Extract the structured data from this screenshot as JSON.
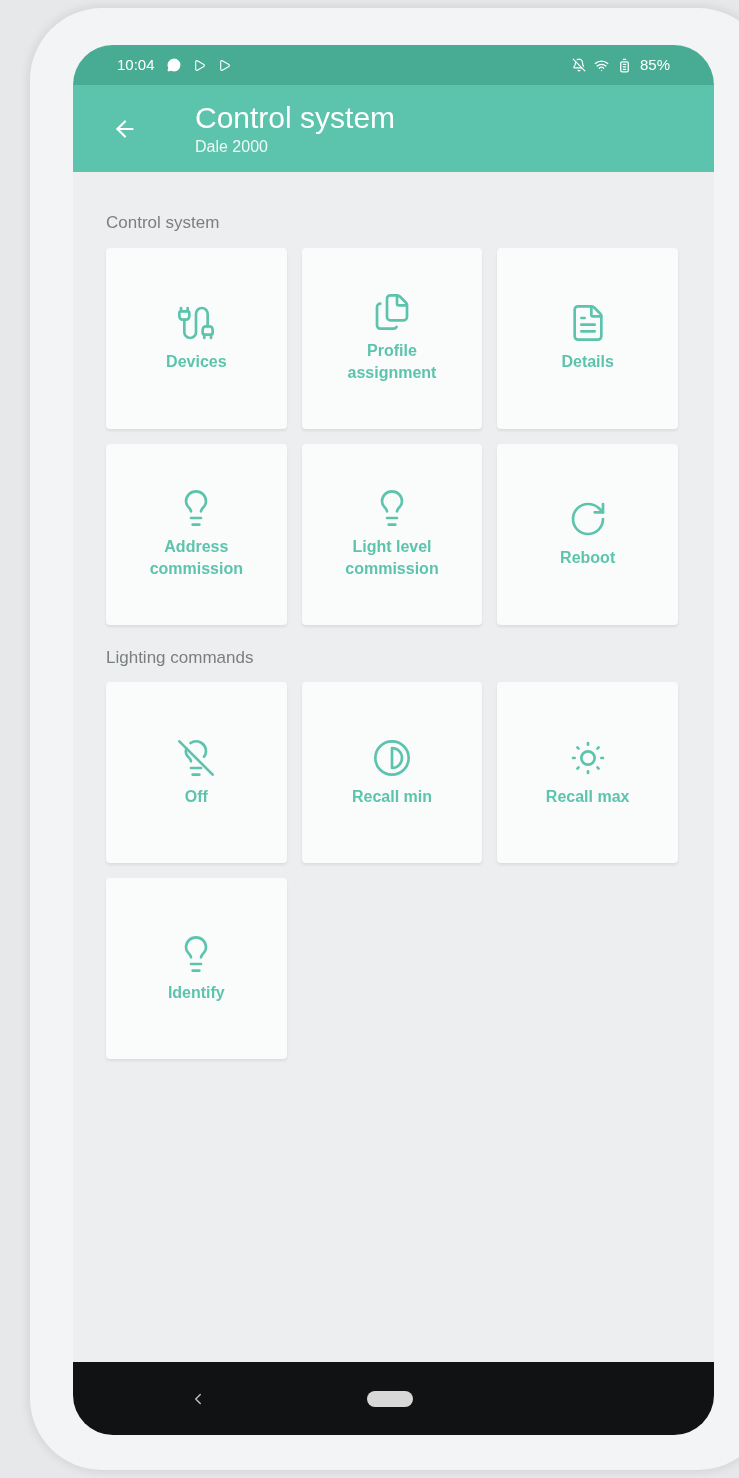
{
  "status_bar": {
    "time": "10:04",
    "battery": "85%"
  },
  "app_bar": {
    "title": "Control system",
    "subtitle": "Dale 2000"
  },
  "sections": [
    {
      "title": "Control system",
      "tiles": [
        {
          "kind": "devices",
          "label": "Devices"
        },
        {
          "kind": "profile",
          "label": "Profile assignment"
        },
        {
          "kind": "details",
          "label": "Details"
        },
        {
          "kind": "address",
          "label": "Address commission"
        },
        {
          "kind": "light_level",
          "label": "Light level commission"
        },
        {
          "kind": "reboot",
          "label": "Reboot"
        }
      ]
    },
    {
      "title": "Lighting commands",
      "tiles": [
        {
          "kind": "off",
          "label": "Off"
        },
        {
          "kind": "recall_min",
          "label": "Recall min"
        },
        {
          "kind": "recall_max",
          "label": "Recall max"
        },
        {
          "kind": "identify",
          "label": "Identify"
        }
      ]
    }
  ]
}
